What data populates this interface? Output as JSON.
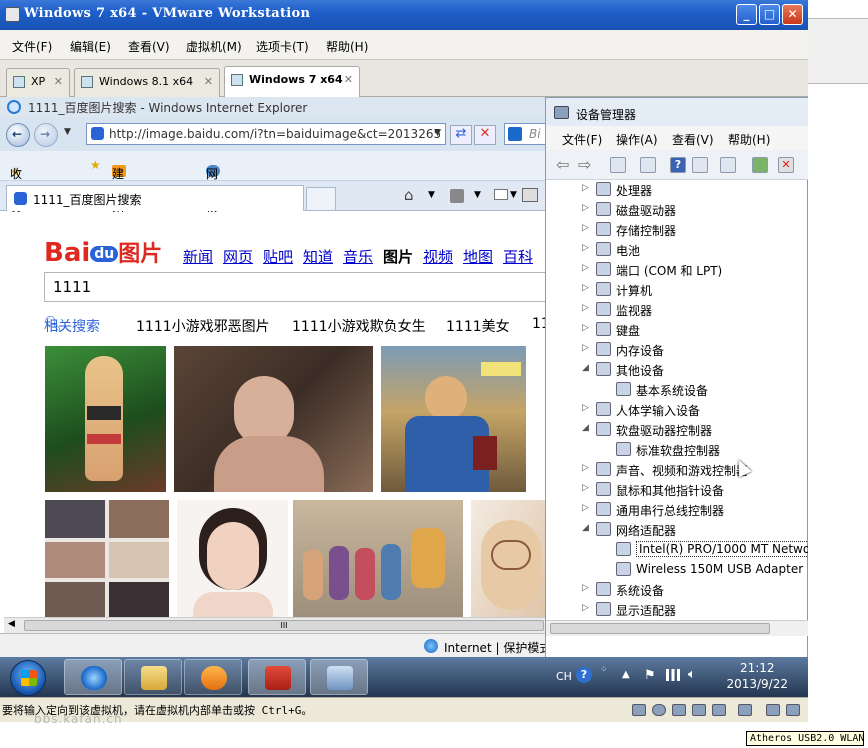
{
  "vm": {
    "title": "Windows 7 x64 - VMware Workstation",
    "menu": [
      "文件(F)",
      "编辑(E)",
      "查看(V)",
      "虚拟机(M)",
      "选项卡(T)",
      "帮助(H)"
    ],
    "tabs": [
      {
        "label": "XP"
      },
      {
        "label": "Windows 8.1 x64"
      },
      {
        "label": "Windows 7 x64"
      }
    ],
    "status_message": "要将输入定向到该虚拟机，请在虚拟机内部单击或按 Ctrl+G。",
    "watermark": "bbs.kafan.cn"
  },
  "ie": {
    "title": "1111_百度图片搜索 - Windows Internet Explorer",
    "address": "http://image.baidu.com/i?tn=baiduimage&ct=2013265",
    "search_stub": "Bi",
    "favorites_label": "收藏夹",
    "fav_items": [
      "建议网站 ▾",
      "网页快讯库 ▾"
    ],
    "tab_label": "1111_百度图片搜索",
    "status_zone": "Internet | 保护模式",
    "scroll_grip": "III"
  },
  "baidu": {
    "logo_bai": "Bai",
    "logo_du": "du",
    "logo_pic": "图片",
    "nav": [
      "新闻",
      "网页",
      "贴吧",
      "知道",
      "音乐",
      "图片",
      "视频",
      "地图",
      "百科"
    ],
    "current_nav": "图片",
    "query": "1111",
    "related_label": "相关搜索",
    "related": [
      "1111小游戏邪恶图片",
      "1111小游戏欺负女生",
      "1111美女",
      "11"
    ]
  },
  "devmgr": {
    "title": "设备管理器",
    "menu": [
      "文件(F)",
      "操作(A)",
      "查看(V)",
      "帮助(H)"
    ],
    "tree": [
      {
        "label": "处理器",
        "level": 0,
        "expanded": false
      },
      {
        "label": "磁盘驱动器",
        "level": 0,
        "expanded": false
      },
      {
        "label": "存储控制器",
        "level": 0,
        "expanded": false
      },
      {
        "label": "电池",
        "level": 0,
        "expanded": false
      },
      {
        "label": "端口 (COM 和 LPT)",
        "level": 0,
        "expanded": false
      },
      {
        "label": "计算机",
        "level": 0,
        "expanded": false
      },
      {
        "label": "监视器",
        "level": 0,
        "expanded": false
      },
      {
        "label": "键盘",
        "level": 0,
        "expanded": false
      },
      {
        "label": "内存设备",
        "level": 0,
        "expanded": false
      },
      {
        "label": "其他设备",
        "level": 0,
        "expanded": true
      },
      {
        "label": "基本系统设备",
        "level": 1
      },
      {
        "label": "人体学输入设备",
        "level": 0,
        "expanded": false
      },
      {
        "label": "软盘驱动器控制器",
        "level": 0,
        "expanded": true
      },
      {
        "label": "标准软盘控制器",
        "level": 1
      },
      {
        "label": "声音、视频和游戏控制器",
        "level": 0,
        "expanded": false
      },
      {
        "label": "鼠标和其他指针设备",
        "level": 0,
        "expanded": false
      },
      {
        "label": "通用串行总线控制器",
        "level": 0,
        "expanded": false
      },
      {
        "label": "网络适配器",
        "level": 0,
        "expanded": true
      },
      {
        "label": "Intel(R) PRO/1000 MT Netwo",
        "level": 1,
        "selected": true
      },
      {
        "label": "Wireless 150M USB Adapter",
        "level": 1
      },
      {
        "label": "系统设备",
        "level": 0,
        "expanded": false
      },
      {
        "label": "显示适配器",
        "level": 0,
        "expanded": false
      }
    ]
  },
  "taskbar": {
    "lang": "CH",
    "time": "21:12",
    "date": "2013/9/22"
  },
  "host": {
    "tooltip": "Atheros USB2.0 WLAN"
  },
  "colors": {
    "titlebar_blue": "#1e5fc9",
    "baidu_red": "#de2920",
    "baidu_blue": "#2a62d8",
    "link_blue": "#0000cc"
  }
}
